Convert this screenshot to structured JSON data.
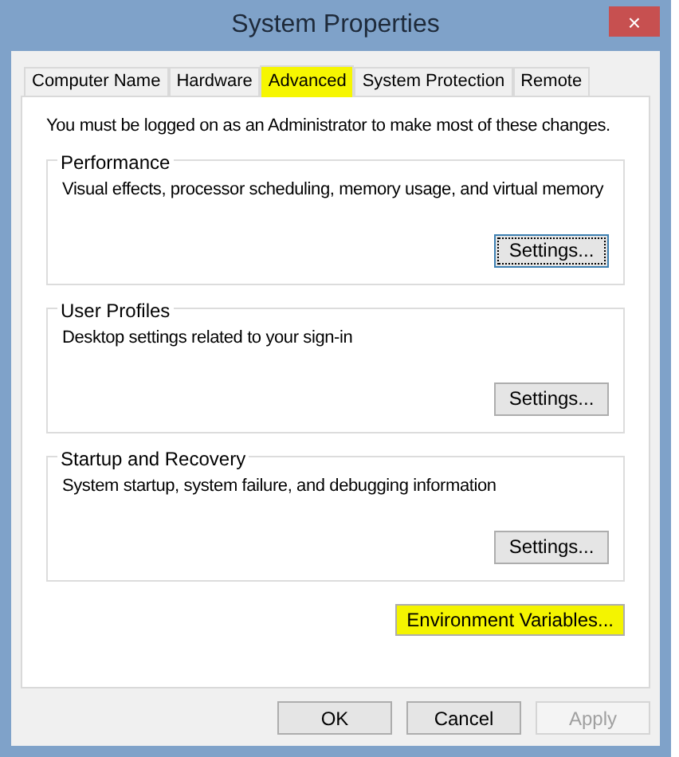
{
  "window": {
    "title": "System Properties",
    "close": "×"
  },
  "tabs": [
    {
      "label": "Computer Name",
      "selected": false,
      "highlighted": false
    },
    {
      "label": "Hardware",
      "selected": false,
      "highlighted": false
    },
    {
      "label": "Advanced",
      "selected": true,
      "highlighted": true
    },
    {
      "label": "System Protection",
      "selected": false,
      "highlighted": false
    },
    {
      "label": "Remote",
      "selected": false,
      "highlighted": false
    }
  ],
  "notice": "You must be logged on as an Administrator to make most of these changes.",
  "groups": [
    {
      "title": "Performance",
      "description": "Visual effects, processor scheduling, memory usage, and virtual memory",
      "button": "Settings...",
      "focused": true
    },
    {
      "title": "User Profiles",
      "description": "Desktop settings related to your sign-in",
      "button": "Settings...",
      "focused": false
    },
    {
      "title": "Startup and Recovery",
      "description": "System startup, system failure, and debugging information",
      "button": "Settings...",
      "focused": false
    }
  ],
  "environment_button": {
    "label": "Environment Variables...",
    "highlighted": true
  },
  "buttons": [
    {
      "label": "OK",
      "disabled": false
    },
    {
      "label": "Cancel",
      "disabled": false
    },
    {
      "label": "Apply",
      "disabled": true
    }
  ]
}
